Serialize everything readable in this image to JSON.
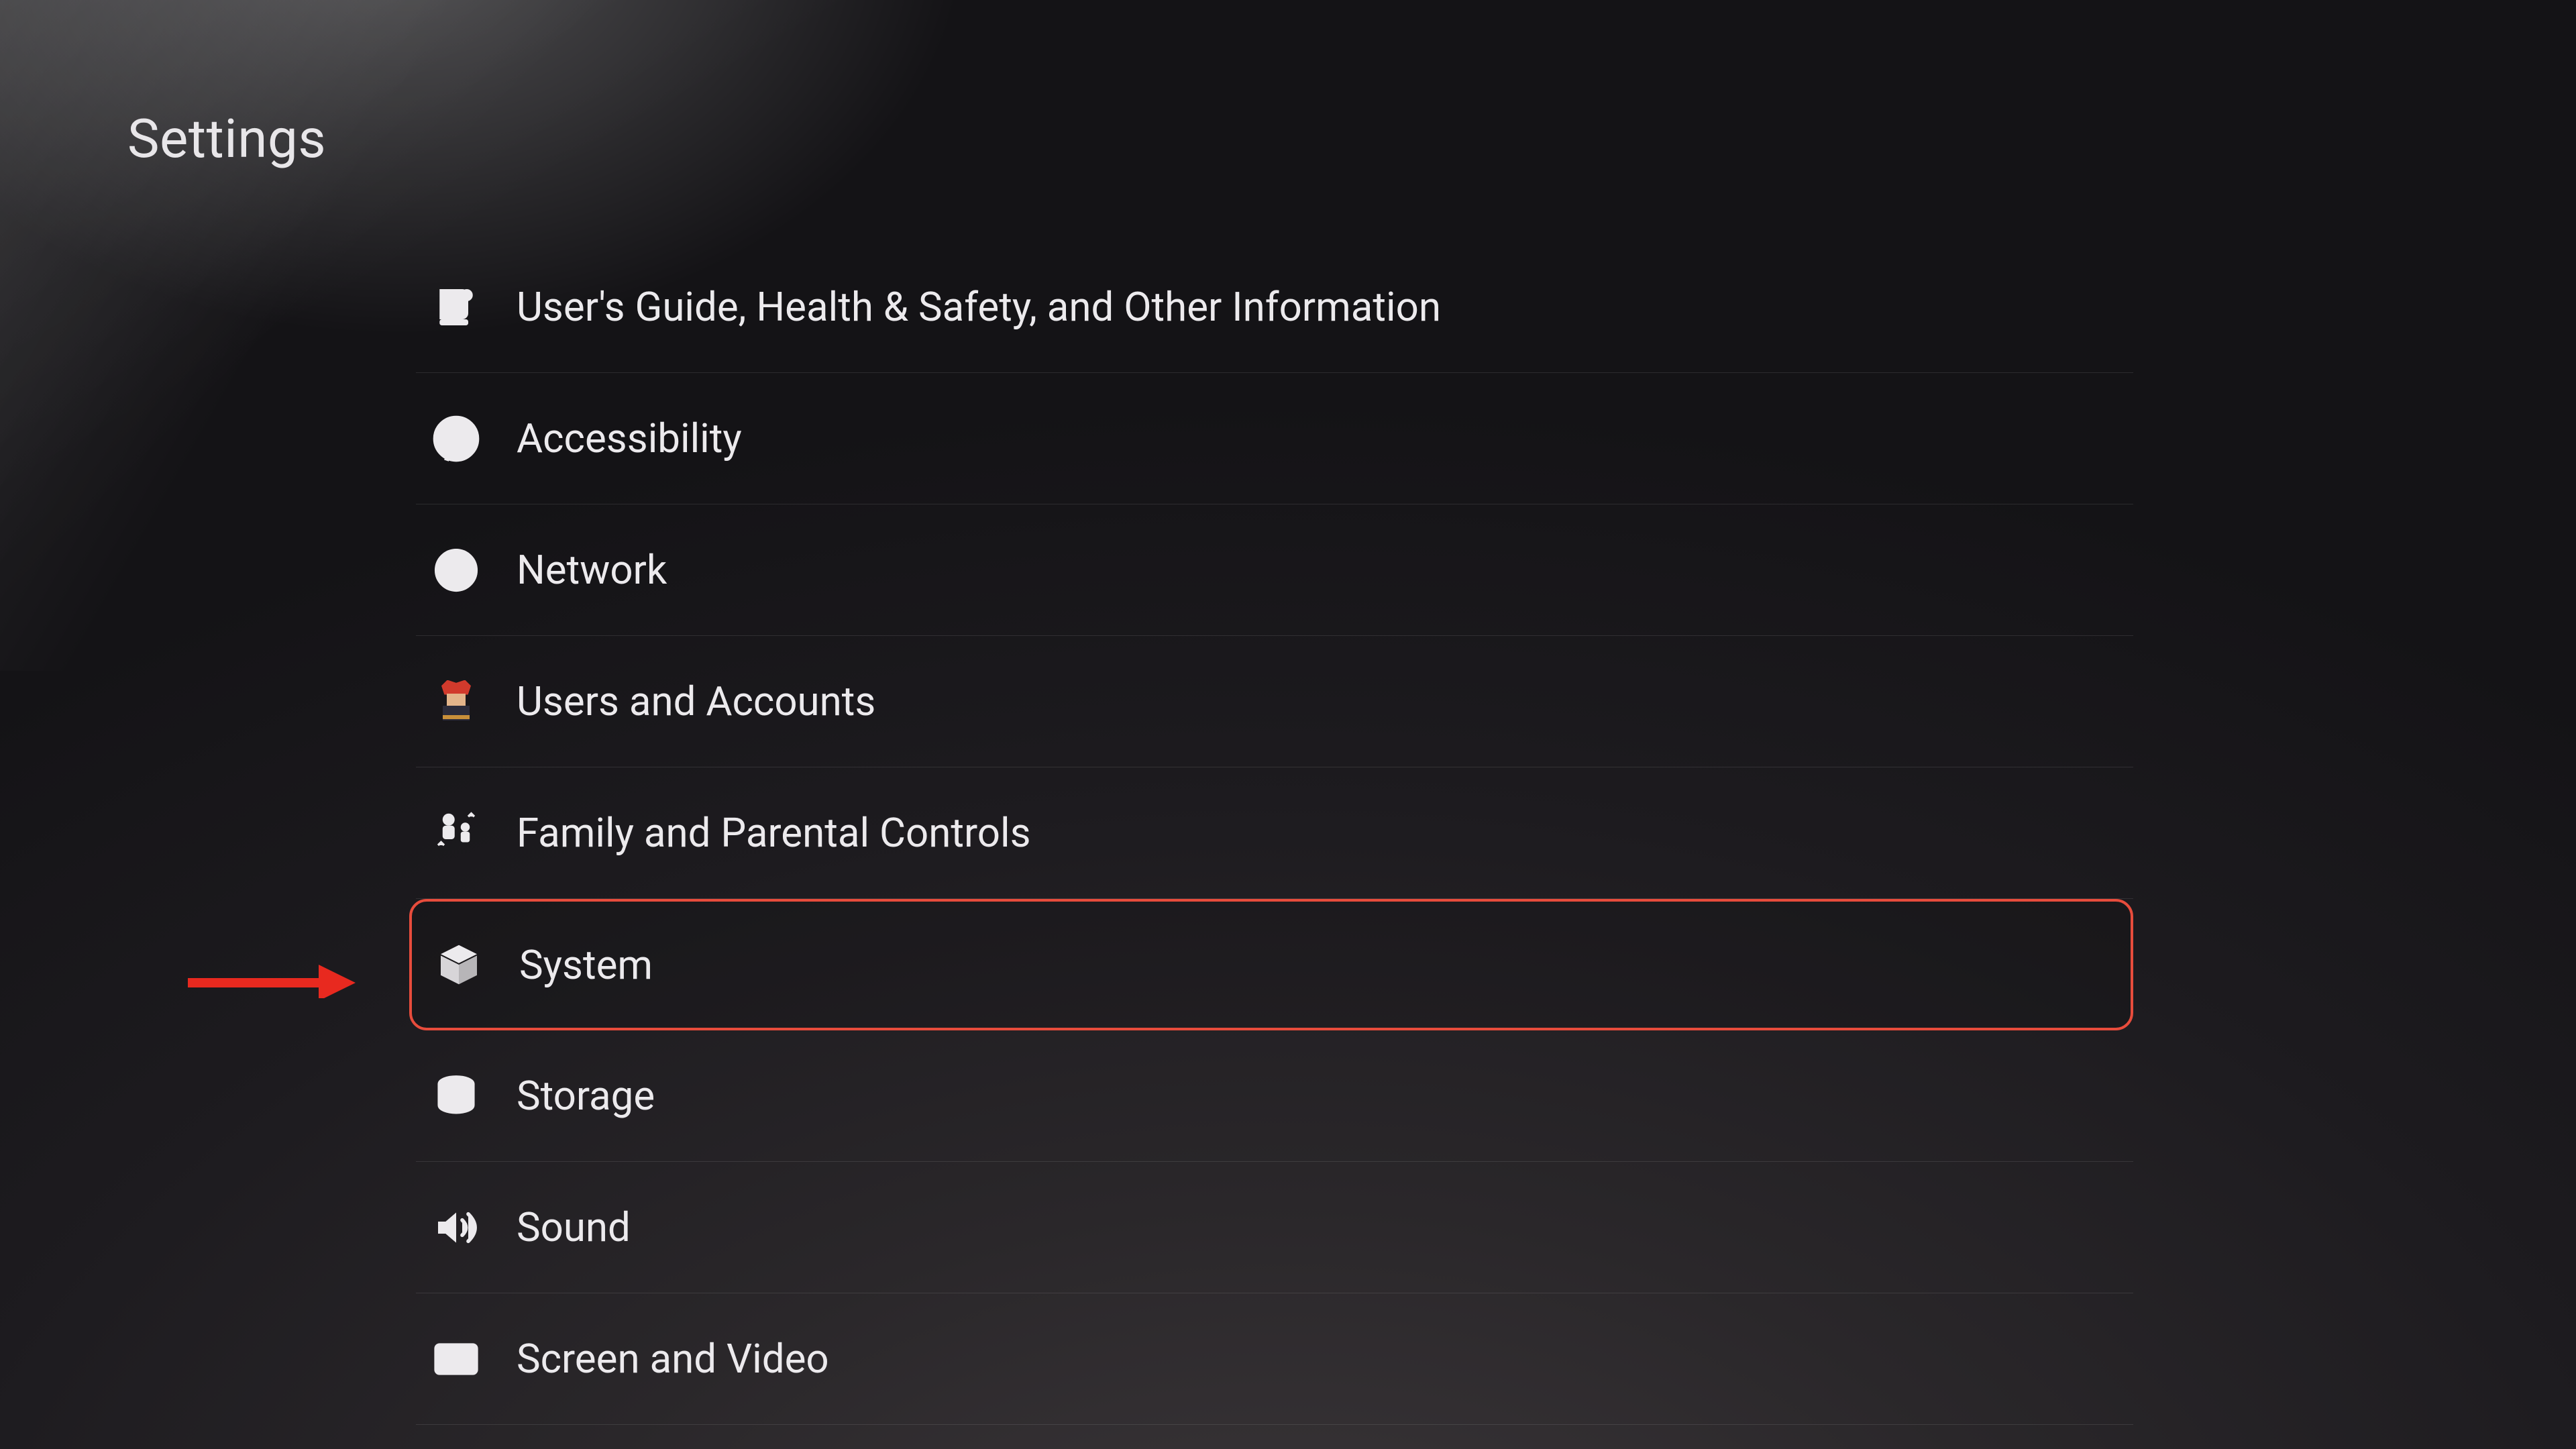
{
  "header": {
    "title": "Settings"
  },
  "menu": {
    "items": [
      {
        "id": "guide",
        "label": "User's Guide, Health & Safety, and Other Information",
        "icon": "guide-icon"
      },
      {
        "id": "accessibility",
        "label": "Accessibility",
        "icon": "accessibility-icon"
      },
      {
        "id": "network",
        "label": "Network",
        "icon": "globe-icon"
      },
      {
        "id": "users",
        "label": "Users and Accounts",
        "icon": "avatar-icon"
      },
      {
        "id": "family",
        "label": "Family and Parental Controls",
        "icon": "family-icon"
      },
      {
        "id": "system",
        "label": "System",
        "icon": "cube-icon",
        "highlighted": true
      },
      {
        "id": "storage",
        "label": "Storage",
        "icon": "storage-icon"
      },
      {
        "id": "sound",
        "label": "Sound",
        "icon": "speaker-icon"
      },
      {
        "id": "screen",
        "label": "Screen and Video",
        "icon": "screen-icon"
      }
    ]
  },
  "annotation": {
    "target": "system",
    "color": "#e8291f"
  }
}
